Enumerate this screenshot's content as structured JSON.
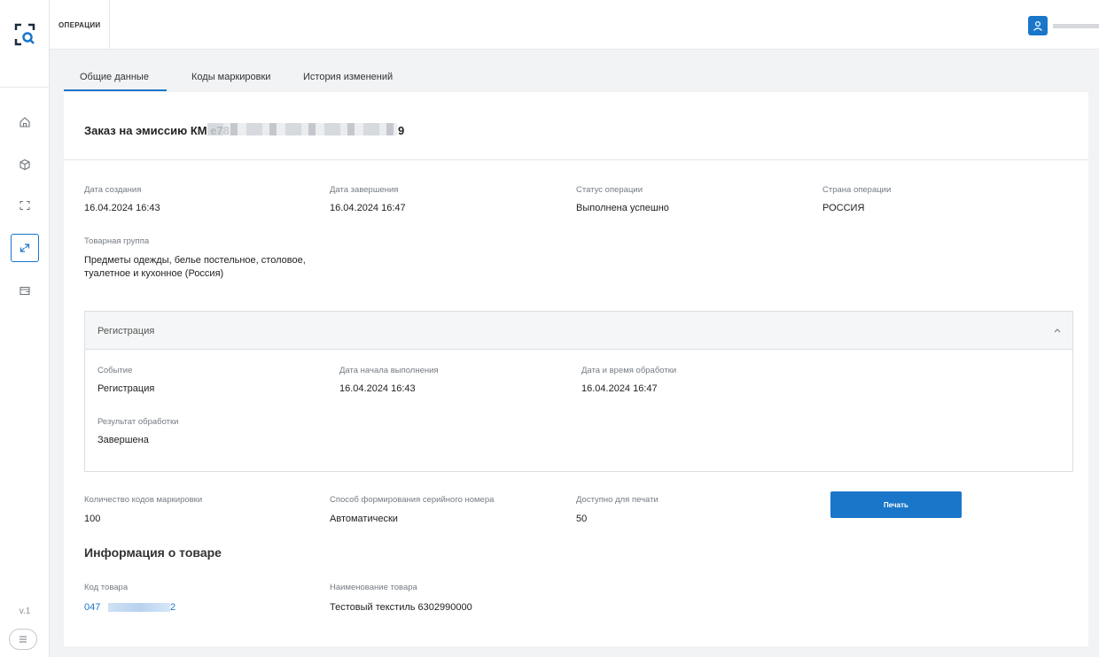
{
  "app": {
    "version": "v.1",
    "accent": "#1976c9"
  },
  "topbar": {
    "section_tab": "ОПЕРАЦИИ"
  },
  "tabs": [
    {
      "label": "Общие данные",
      "active": true
    },
    {
      "label": "Коды маркировки",
      "active": false
    },
    {
      "label": "История изменений",
      "active": false
    }
  ],
  "sidebar": {
    "items": [
      {
        "icon": "home-icon",
        "active": false
      },
      {
        "icon": "box-icon",
        "active": false
      },
      {
        "icon": "scan-frame-icon",
        "active": false
      },
      {
        "icon": "arrows-exchange-icon",
        "active": true
      },
      {
        "icon": "wallet-icon",
        "active": false
      }
    ]
  },
  "order": {
    "title_prefix": "Заказ на эмиссию КМ e78",
    "title_suffix": "9"
  },
  "general": {
    "created_label": "Дата создания",
    "created_value": "16.04.2024 16:43",
    "finished_label": "Дата завершения",
    "finished_value": "16.04.2024 16:47",
    "status_label": "Статус операции",
    "status_value": "Выполнена успешно",
    "country_label": "Страна операции",
    "country_value": "РОССИЯ",
    "group_label": "Товарная группа",
    "group_value": "Предметы одежды, белье постельное, столовое, туалетное и кухонное (Россия)"
  },
  "registration": {
    "title": "Регистрация",
    "event_label": "Событие",
    "event_value": "Регистрация",
    "start_label": "Дата начала выполнения",
    "start_value": "16.04.2024 16:43",
    "processed_label": "Дата и время обработки",
    "processed_value": "16.04.2024 16:47",
    "result_label": "Результат обработки",
    "result_value": "Завершена"
  },
  "codes": {
    "count_label": "Количество кодов маркировки",
    "count_value": "100",
    "serial_label": "Способ формирования серийного номера",
    "serial_value": "Автоматически",
    "print_label": "Доступно для печати",
    "print_value": "50",
    "print_button": "Печать"
  },
  "product": {
    "section_title": "Информация о товаре",
    "code_label": "Код товара",
    "code_prefix": "047",
    "code_suffix": "2",
    "name_label": "Наименование товара",
    "name_value": "Тестовый текстиль 6302990000"
  }
}
